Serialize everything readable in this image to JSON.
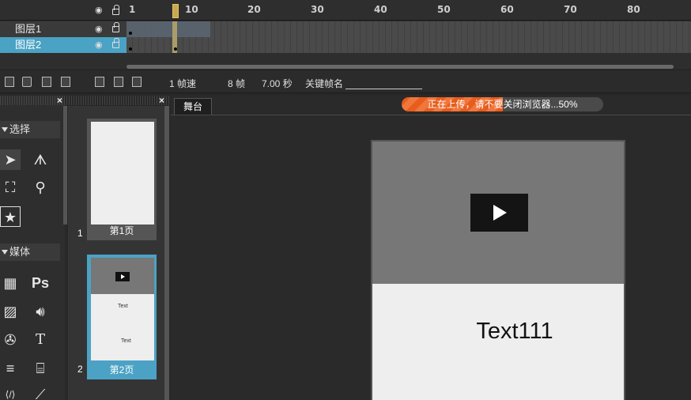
{
  "timeline": {
    "ruler": [
      "1",
      "10",
      "20",
      "30",
      "40",
      "50",
      "60",
      "70",
      "80"
    ],
    "layers": [
      {
        "name": "图层1",
        "selected": false
      },
      {
        "name": "图层2",
        "selected": true
      }
    ]
  },
  "toolbar": {
    "fps_label": "1 帧速",
    "frames_label": "8 帧",
    "seconds_label": "7.00 秒",
    "keyframe_label": "关键帧名"
  },
  "tools": {
    "section_select": "选择",
    "section_media": "媒体",
    "ps_label": "Ps",
    "text_label": "T"
  },
  "pages": [
    {
      "number": "1",
      "label": "第1页",
      "selected": false
    },
    {
      "number": "2",
      "label": "第2页",
      "selected": true,
      "text1": "Text",
      "text2": "Text"
    }
  ],
  "stage": {
    "tab": "舞台",
    "upload_text": "正在上传，请不要关闭浏览器...50%",
    "upload_progress": 0.5,
    "canvas_text": "Text111"
  },
  "colors": {
    "accent": "#4ba2c4",
    "upload": "#e85d1d",
    "playhead": "#c9a84d"
  }
}
